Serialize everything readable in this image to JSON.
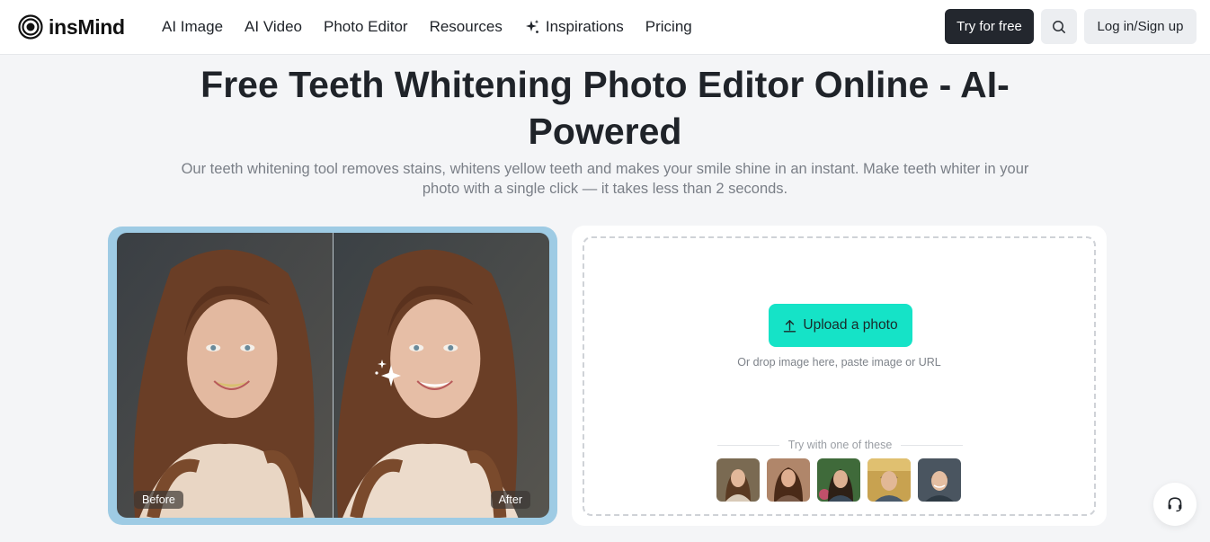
{
  "brand": {
    "name": "insMind",
    "logo_icon": "insmind-logo-icon"
  },
  "nav": {
    "items": [
      {
        "label": "AI Image"
      },
      {
        "label": "AI Video"
      },
      {
        "label": "Photo Editor"
      },
      {
        "label": "Resources"
      },
      {
        "label": "Inspirations",
        "icon": "sparkle-icon"
      },
      {
        "label": "Pricing"
      }
    ],
    "try_label": "Try for free",
    "search_icon": "search-icon",
    "login_label": "Log in/Sign up"
  },
  "hero": {
    "title": "Free Teeth Whitening Photo Editor Online - AI-Powered",
    "subtitle": "Our teeth whitening tool removes stains, whitens yellow teeth and makes your smile shine in an instant. Make teeth whiter in your photo with a single click — it takes less than 2 seconds."
  },
  "compare": {
    "before_label": "Before",
    "after_label": "After"
  },
  "upload": {
    "button_label": "Upload a photo",
    "drop_hint": "Or drop image here, paste image or URL",
    "try_label": "Try with one of these"
  },
  "help": {
    "icon": "headset-icon"
  },
  "colors": {
    "accent": "#15e3c7",
    "primary_dark": "#23272e",
    "compare_frame": "#9ecbe4",
    "page_bg": "#f4f5f7"
  }
}
